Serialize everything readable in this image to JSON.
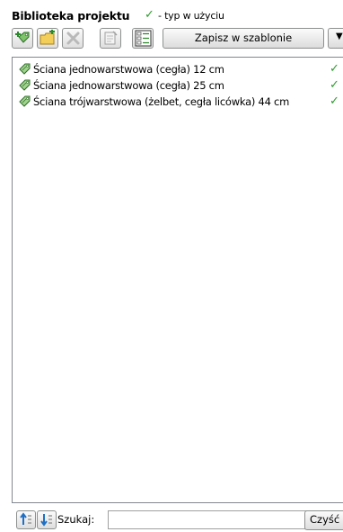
{
  "header": {
    "title": "Biblioteka projektu",
    "legend_check": "✓",
    "legend_text": "- typ w użyciu"
  },
  "toolbar": {
    "save_label": "Zapisz w szablonie",
    "dropdown_glyph": "▼"
  },
  "list": {
    "items": [
      {
        "name": "Ściana jednowarstwowa (cegła) 12 cm",
        "in_use": "✓"
      },
      {
        "name": "Ściana jednowarstwowa (cegła) 25 cm",
        "in_use": "✓"
      },
      {
        "name": "Ściana trójwarstwowa (żelbet, cegła licówka) 44 cm",
        "in_use": "✓"
      }
    ]
  },
  "search": {
    "label": "Szukaj:",
    "value": "",
    "placeholder": "",
    "clear_label": "Czyść"
  },
  "colors": {
    "check": "#2e9b2e",
    "icon_green": "#3a9a32"
  }
}
